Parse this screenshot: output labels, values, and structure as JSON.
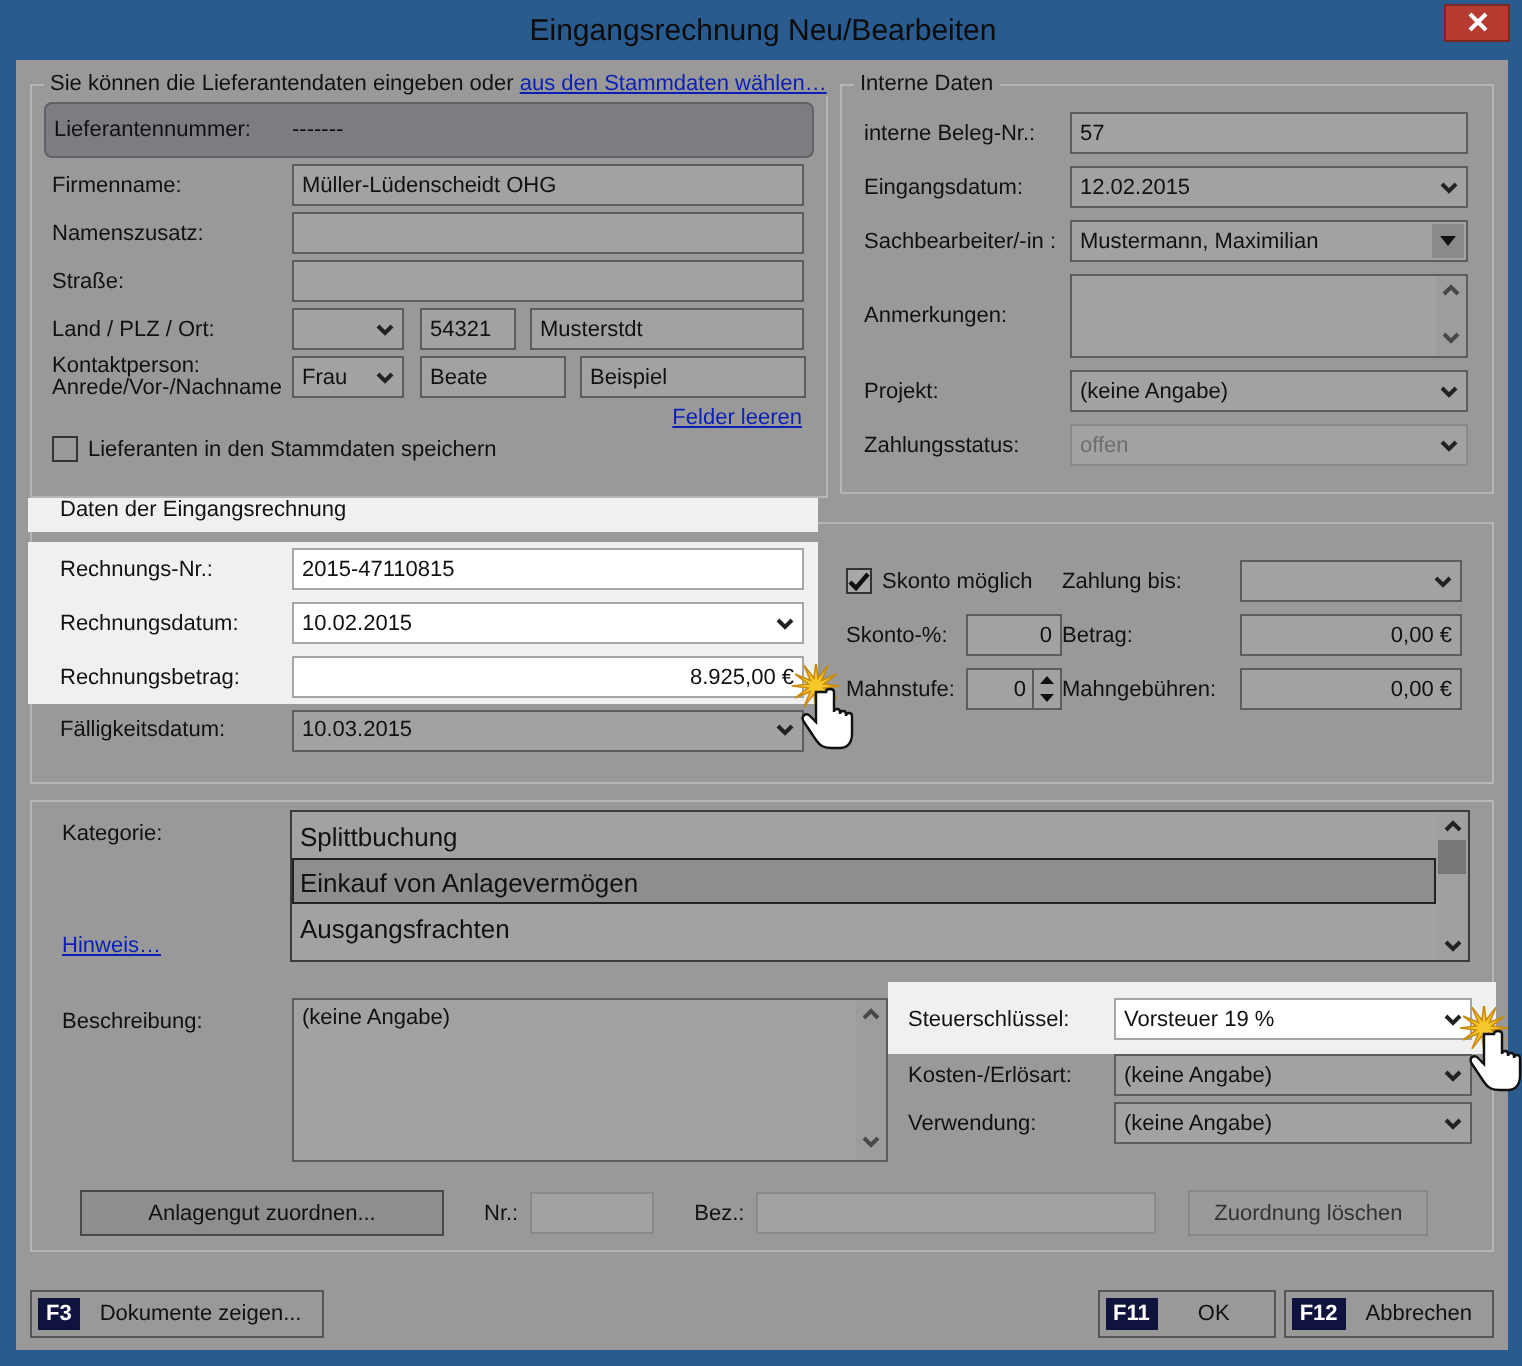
{
  "window": {
    "title": "Eingangsrechnung Neu/Bearbeiten"
  },
  "supplier": {
    "intro": "Sie können die Lieferantendaten eingeben oder",
    "link": "aus den Stammdaten wählen…",
    "number_label": "Lieferantennummer:",
    "number_value": "-------",
    "rows": [
      {
        "kind": "single",
        "label": "Firmenname:",
        "fields": [
          {
            "kind": "text",
            "value": "Müller-Lüdenscheidt OHG"
          }
        ]
      },
      {
        "kind": "single",
        "label": "Namenszusatz:",
        "fields": [
          {
            "kind": "text"
          }
        ]
      },
      {
        "kind": "single",
        "label": "Straße:",
        "fields": [
          {
            "kind": "text"
          }
        ]
      },
      {
        "kind": "location",
        "label": "Land / PLZ / Ort:",
        "fields": [
          {
            "kind": "combo"
          },
          {
            "kind": "text",
            "value": "54321"
          },
          {
            "kind": "text",
            "value": "Musterstdt"
          }
        ]
      },
      {
        "kind": "contact",
        "label": "Kontaktperson:\nAnrede/Vor-/Nachname",
        "fields": [
          {
            "kind": "combo",
            "value": "Frau"
          },
          {
            "kind": "text",
            "value": "Beate"
          },
          {
            "kind": "text",
            "value": "Beispiel"
          }
        ]
      }
    ],
    "clear_link": "Felder leeren",
    "save_checkbox": {
      "label": "Lieferanten in den Stammdaten speichern",
      "checked": false
    }
  },
  "internal": {
    "legend": "Interne Daten",
    "rows": [
      {
        "label": "interne Beleg-Nr.:",
        "kind": "text",
        "value": "57",
        "disabled": false
      },
      {
        "label": "Eingangsdatum:",
        "kind": "combo",
        "value": "12.02.2015",
        "disabled": false
      },
      {
        "label": "Sachbearbeiter/-in :",
        "kind": "dropdown",
        "value": "Mustermann, Maximilian",
        "disabled": false
      },
      {
        "label": "Anmerkungen:",
        "kind": "textarea",
        "disabled": false
      },
      {
        "label": "Projekt:",
        "kind": "combo",
        "value": "(keine Angabe)",
        "disabled": false
      },
      {
        "label": "Zahlungsstatus:",
        "kind": "combo",
        "value": "offen",
        "disabled": true
      }
    ]
  },
  "invoice": {
    "legend": "Daten der Eingangsrechnung",
    "highlighted": true,
    "rows": [
      {
        "label": "Rechnungs-Nr.:",
        "kind": "text",
        "value": "2015-47110815",
        "highlighted": true,
        "pointer": false
      },
      {
        "label": "Rechnungsdatum:",
        "kind": "combo",
        "value": "10.02.2015",
        "highlighted": true,
        "pointer": false
      },
      {
        "label": "Rechnungsbetrag:",
        "kind": "amount",
        "value": "8.925,00 €",
        "highlighted": true,
        "pointer": true
      },
      {
        "label": "Fälligkeitsdatum:",
        "kind": "combo",
        "value": "10.03.2015",
        "highlighted": false,
        "pointer": false
      }
    ]
  },
  "skonto": {
    "checkbox": {
      "label": "Skonto möglich",
      "checked": true
    },
    "percent": {
      "label": "Skonto-%:",
      "value": "0"
    },
    "dunning": {
      "label": "Mahnstufe:",
      "value": "0"
    },
    "pay_until": {
      "label": "Zahlung bis:"
    },
    "amount": {
      "label": "Betrag:",
      "value": "0,00 €"
    },
    "fees": {
      "label": "Mahngebühren:",
      "value": "0,00 €"
    }
  },
  "booking": {
    "category_label": "Kategorie:",
    "categories": [
      {
        "label": "Splittbuchung",
        "selected": false
      },
      {
        "label": "Einkauf von Anlagevermögen",
        "selected": true
      },
      {
        "label": "Ausgangsfrachten",
        "selected": false
      }
    ],
    "hint_link": "Hinweis…",
    "description_label": "Beschreibung:",
    "description": "(keine Angabe)",
    "rows": [
      {
        "label": "Steuerschlüssel:",
        "value": "Vorsteuer 19 %",
        "highlighted": true,
        "pointer": true
      },
      {
        "label": "Kosten-/Erlösart:",
        "value": "(keine Angabe)",
        "highlighted": false,
        "pointer": false
      },
      {
        "label": "Verwendung:",
        "value": "(keine Angabe)",
        "highlighted": false,
        "pointer": false
      }
    ],
    "asset": {
      "button": "Anlagengut zuordnen...",
      "nr_label": "Nr.:",
      "bez_label": "Bez.:",
      "clear_button": "Zuordnung löschen"
    }
  },
  "footer": {
    "left": [
      {
        "key": "F3",
        "label": "Dokumente zeigen..."
      }
    ],
    "right": [
      {
        "key": "F11",
        "label": "OK"
      },
      {
        "key": "F12",
        "label": "Abbrechen"
      }
    ]
  }
}
